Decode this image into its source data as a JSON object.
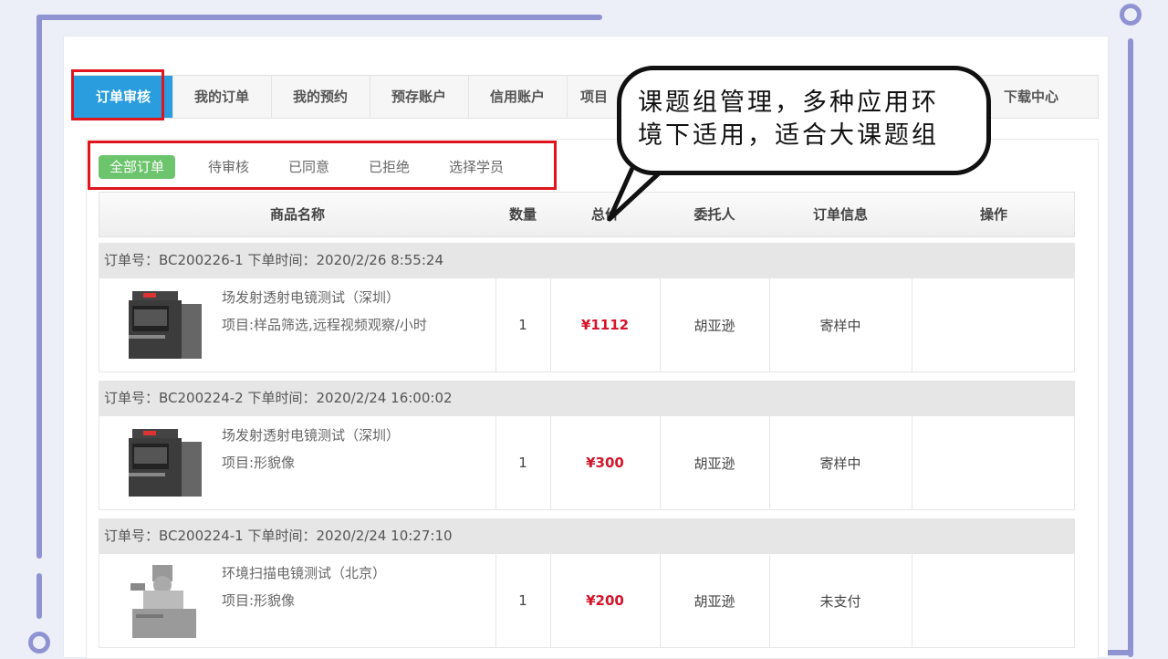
{
  "tabs": [
    {
      "label": "订单审核",
      "active": true
    },
    {
      "label": "我的订单"
    },
    {
      "label": "我的预约"
    },
    {
      "label": "预存账户"
    },
    {
      "label": "信用账户"
    },
    {
      "label": "项目"
    },
    {
      "label": "下载中心"
    }
  ],
  "filters": [
    {
      "label": "全部订单",
      "active": true
    },
    {
      "label": "待审核"
    },
    {
      "label": "已同意"
    },
    {
      "label": "已拒绝"
    },
    {
      "label": "选择学员"
    }
  ],
  "columns": {
    "name": "商品名称",
    "qty": "数量",
    "total": "总价",
    "client": "委托人",
    "info": "订单信息",
    "action": "操作"
  },
  "orders": [
    {
      "header": "订单号：BC200226-1  下单时间：2020/2/26 8:55:24",
      "product": "场发射透射电镜测试（深圳）",
      "project": "项目:样品筛选,远程视频观察/小时",
      "qty": "1",
      "price": "¥1112",
      "client": "胡亚逊",
      "status": "寄样中"
    },
    {
      "header": "订单号：BC200224-2  下单时间：2020/2/24 16:00:02",
      "product": "场发射透射电镜测试（深圳）",
      "project": "项目:形貌像",
      "qty": "1",
      "price": "¥300",
      "client": "胡亚逊",
      "status": "寄样中"
    },
    {
      "header": "订单号：BC200224-1  下单时间：2020/2/24 10:27:10",
      "product": "环境扫描电镜测试（北京）",
      "project": "项目:形貌像",
      "qty": "1",
      "price": "¥200",
      "client": "胡亚逊",
      "status": "未支付"
    }
  ],
  "annotation": {
    "line1": "课题组管理，多种应用环",
    "line2": "境下适用，适合大课题组"
  },
  "colors": {
    "active_tab": "#2a9ddf",
    "active_filter": "#6cc46c",
    "price": "#d4142a",
    "highlight_box": "#e0141d",
    "frame": "#8f93d2"
  }
}
